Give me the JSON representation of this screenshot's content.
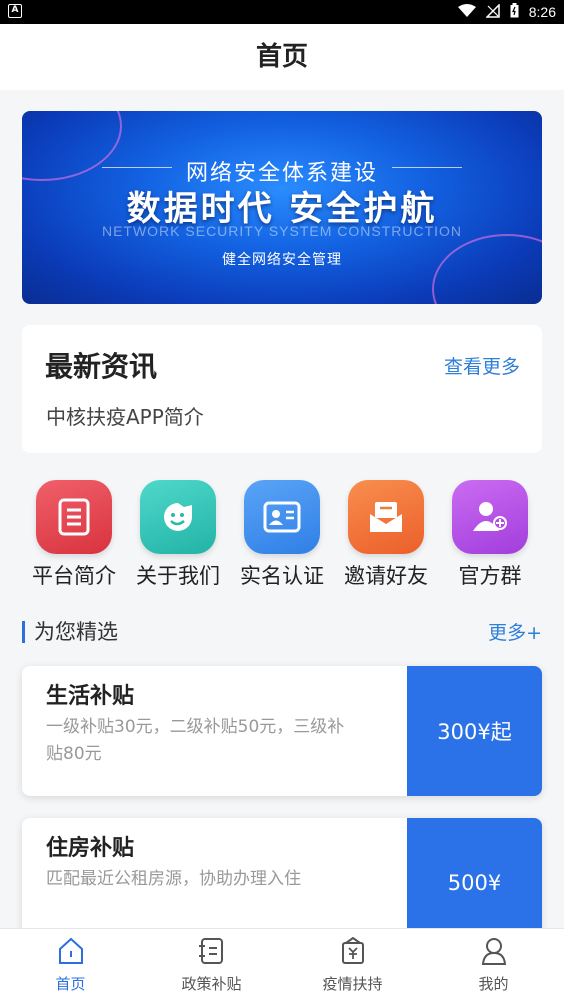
{
  "status_bar": {
    "left_icon": "A",
    "time": "8:26",
    "icons": [
      "wifi-icon",
      "signal-icon",
      "battery-icon"
    ]
  },
  "header": {
    "title": "首页"
  },
  "banner": {
    "subtitle": "网络安全体系建设",
    "headline": "数据时代 安全护航",
    "english": "NETWORK SECURITY SYSTEM CONSTRUCTION",
    "tagline": "健全网络安全管理"
  },
  "news": {
    "title_prefix": "最新",
    "title_suffix": "资讯",
    "more": "查看更多",
    "item": "中核扶疫APP简介"
  },
  "grid": [
    {
      "label": "平台简介",
      "icon": "document-icon",
      "color": "#e0414b"
    },
    {
      "label": "关于我们",
      "icon": "smile-chat-icon",
      "color": "#2ec7b9"
    },
    {
      "label": "实名认证",
      "icon": "id-card-icon",
      "color": "#3b8ef0"
    },
    {
      "label": "邀请好友",
      "icon": "envelope-icon",
      "color": "#f2713a"
    },
    {
      "label": "官方群",
      "icon": "group-icon",
      "color": "#b44de6"
    }
  ],
  "section": {
    "title": "为您精选",
    "more": "更多+"
  },
  "cards": [
    {
      "title": "生活补贴",
      "desc": "一级补贴30元，二级补贴50元，三级补贴80元",
      "price": "300¥起"
    },
    {
      "title": "住房补贴",
      "desc": "匹配最近公租房源，协助办理入住",
      "price": "500¥"
    }
  ],
  "tabs": [
    {
      "label": "首页",
      "icon": "home-icon",
      "active": true
    },
    {
      "label": "政策补贴",
      "icon": "policy-icon",
      "active": false
    },
    {
      "label": "疫情扶持",
      "icon": "wallet-icon",
      "active": false
    },
    {
      "label": "我的",
      "icon": "user-icon",
      "active": false
    }
  ],
  "colors": {
    "accent": "#2e6fe0",
    "price_bg": "#2b72e8",
    "link": "#2e7fd8"
  }
}
